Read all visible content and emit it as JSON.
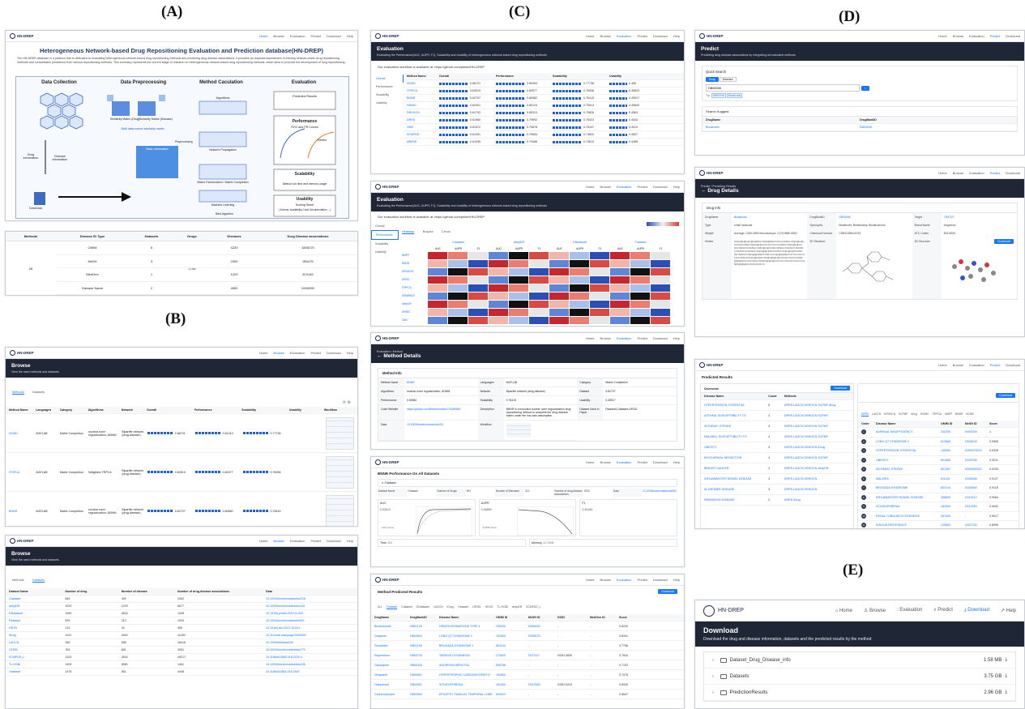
{
  "panel_labels": {
    "a": "(A)",
    "b": "(B)",
    "c": "(C)",
    "d": "(D)",
    "e": "(E)"
  },
  "brand": "HN-DREP",
  "nav": [
    "Home",
    "Browse",
    "Evaluation",
    "Predict",
    "Download",
    "Help"
  ],
  "a": {
    "title": "Heterogeneous Network-based Drug Repositioning Evaluation and Prediction database(HN-DREP)",
    "intro": "The HN-DREP database is a platform that is dedicated to evaluating heterogeneous network-based drug repositioning methods and predicting drug disease associations. It provides an impartial assessment of existing network-driven drug repositioning methods and consolidates predictions from various repositioning methods. This summary represents the current stage of research on heterogeneous network-based drug repositioning methods, which aims to promote the development of drug repositioning.",
    "flow": [
      "Data Collection",
      "Data Preprocessing",
      "Method Caculation",
      "Evaluation"
    ],
    "flow_labels": {
      "drug_info": "Drug information",
      "disease_info": "Disease information",
      "download": "Download",
      "sim_drug": "Similarity Matrix (Drug)",
      "sim_disease": "Similarity Matrix (Disease)",
      "multi_source": "Multi data source similarity matrix",
      "preprocessing": "Preprocessing",
      "basic_info": "Basic information",
      "algorithms": "Algorithms",
      "network_prop": "Network Propagation",
      "matrix_fact": "Matrix Factorization / Matrix Completion",
      "ml": "Machine Learning",
      "best_alg": "Best Algorithm",
      "predicted": "Predicted Results",
      "performance": "Performance",
      "roc": "ROC and PR Curves",
      "metrics": "Metrics",
      "scalability": "Scalability",
      "scal_desc": "Method run time and memory usage",
      "usability": "Usability",
      "scoring": "Scoring Sheet",
      "scoring_desc": "( 6 items: Availability Code Documentation ...)"
    },
    "table": {
      "headers": [
        "Methods",
        "Disease ID Type",
        "Datasets",
        "Drugs",
        "Diseases",
        "Drug Disease associations"
      ],
      "methods": "28",
      "drugs": "2798",
      "rows": [
        [
          "OMIM",
          "5",
          "4220",
          "1805270"
        ],
        [
          "MeSH",
          "3",
          "2392",
          "950475"
        ],
        [
          "MedGen",
          "1",
          "1229",
          "874145"
        ],
        [
          "Disease Name",
          "2",
          "4552",
          "2490059"
        ]
      ]
    }
  },
  "b": {
    "title": "Browse",
    "subtitle": "View the used methods and datasets",
    "tabs": [
      "Methods",
      "Datasets"
    ],
    "methods_headers": [
      "Method Name",
      "Languages",
      "Category",
      "Algorithms",
      "Network",
      "Overall",
      "Performance",
      "Scalability",
      "Usability",
      "Workflow"
    ],
    "methods_rows": [
      [
        "NCMD",
        "MATLAB",
        "Matrix Completion",
        "nuclear-norm regularization, ADMM",
        "Bipartite network (drug-disease)",
        "0.66721",
        "0.81313",
        "0.77736"
      ],
      [
        "ITRPCA",
        "MATLAB",
        "Matrix Completion",
        "Weighted-TRPCA",
        "Bipartite network (drug-disease)",
        "0.63919",
        "0.81577",
        "0.76936"
      ],
      [
        "BNNR",
        "MATLAB",
        "Matrix Completion",
        "nuclear-norm regularization, ADMM",
        "Bipartite network (drug-disease)",
        "0.62707",
        "0.80582",
        "0.76415"
      ]
    ],
    "dataset_headers": [
      "Dataset Name",
      "Number of drug",
      "Number of disease",
      "Number of drug-disease associations",
      "Data"
    ],
    "dataset_rows": [
      [
        "Cdataset",
        "663",
        "409",
        "2352",
        "10.1093/bioinformatics/btw228"
      ],
      [
        "deepDR",
        "1519",
        "1229",
        "6677",
        "10.1093/bioinformatics/btz418"
      ],
      [
        "DNdataset",
        "1490",
        "4516",
        "1008",
        "10.1016/j.ymeth.2019.11.002"
      ],
      [
        "Fdataset",
        "593",
        "313",
        "1933",
        "10.1093/bioinformatics/btr500"
      ],
      [
        "HDVD",
        "219",
        "34",
        "455",
        "10.1016/j.isci.2021.101114"
      ],
      [
        "iDrug",
        "1321",
        "2000",
        "11189",
        "10.1111/sdi.mainpage.0000000"
      ],
      [
        "LAGCN",
        "269",
        "598",
        "18416",
        "10.1093/bib/bbaa150"
      ],
      [
        "LRSSL",
        "763",
        "681",
        "3051",
        "10.1093/bioinformatics/btw770"
      ],
      [
        "SCMFDD_L",
        "1323",
        "2834",
        "49217",
        "10.1186/s12859-018-2220-4"
      ],
      [
        "TL-HGBI",
        "1409",
        "5080",
        "1461",
        "10.1093/bioinformatics/btw045"
      ],
      [
        "Ydataset",
        "1478",
        "651",
        "4448",
        "10.1186/s12864-016-2947"
      ]
    ]
  },
  "c": {
    "title": "Evaluation",
    "subtitle": "Evaluating the Performance(AUC, AUPR, F1), Scalability and Usability of heterogeneous network-based drug repositioning methods",
    "workflow": "Our evaluation workflow is available at: https://github.com/pblab/HN-DREP",
    "side": [
      "Overall",
      "Performance",
      "Scalability",
      "Usability"
    ],
    "overall_headers": [
      "Method Name",
      "Overall",
      "Performance",
      "Scalability",
      "Usability"
    ],
    "overall_rows": [
      [
        "NCMD",
        "0.66721",
        "0.80353",
        "0.77736",
        "0.456"
      ],
      [
        "ITRPCA",
        "0.63919",
        "0.80577",
        "0.76936",
        "0.45823"
      ],
      [
        "BNNR",
        "0.62707",
        "0.80582",
        "0.76415",
        "0.45917"
      ],
      [
        "HGIMC",
        "0.62001",
        "0.80124",
        "0.75914",
        "0.45840"
      ],
      [
        "DRHGCN",
        "0.61793",
        "0.80313",
        "0.75826",
        "0.4563"
      ],
      [
        "DRRS",
        "0.61960",
        "0.79992",
        "0.75323",
        "0.4543"
      ],
      [
        "OMC",
        "0.61572",
        "0.79878",
        "0.75147",
        "0.4519"
      ],
      [
        "SCMFDD",
        "0.61391",
        "0.79654",
        "0.74820",
        "0.4507"
      ],
      [
        "MBiRW",
        "0.61055",
        "0.79486",
        "0.74610",
        "0.4488"
      ]
    ],
    "perf_tabs": [
      "Heatmap",
      "Boxplot",
      "Circos"
    ],
    "perf_groups": [
      "Cdataset",
      "deepDR",
      "DNdataset",
      "Fdataset"
    ],
    "perf_metrics": [
      "AUC",
      "AUPR",
      "F1"
    ],
    "perf_methods": [
      "NMFP",
      "BNNR",
      "DRHGCN",
      "DRRS",
      "ITRPCA",
      "DRWBNCF",
      "deepDR",
      "DRIMC",
      "OMC"
    ],
    "method_detail": {
      "crumb": "Evaluation / Method",
      "title": "Method Details",
      "section": "Method Info",
      "labels": [
        "Method Name",
        "Languages",
        "Category",
        "Algorithms",
        "Network",
        "Dataset",
        "Performance",
        "Scalability",
        "Usability",
        "Code Website",
        "Description",
        "Dataset Used in Paper",
        "Data",
        "Workflow"
      ],
      "values": [
        "BNNR",
        "MATLAB",
        "Matrix Completion",
        "nuclear-norm regularization, ADMM",
        "Bipartite network (drug-disease)",
        "0.62707",
        "0.80582",
        "0.76415",
        "0.45917",
        "https://github.com/BioinformaticsCSU/BNNR",
        "BNNR is a bounded nuclear norm regularization drug repositioning method to complete the drug-disease matrix under the low-rank assumption.",
        "Fdataset,Cdataset,LRSSL",
        "10.1093/bioinformatics/btz331"
      ]
    },
    "per_dataset": {
      "title": "BNNR Performance On All Datasets",
      "dataset": "Fdataset",
      "labels": [
        "Dataset Name",
        "Number of Drugs",
        "Number of Diseases",
        "Number of drug-disease associations",
        "Data"
      ],
      "values": [
        "Fdataset",
        "593",
        "313",
        "1933",
        "10.1093/bioinformatics/btr500"
      ],
      "metrics": [
        "AUC",
        "AUPR",
        "F1"
      ],
      "auc": "0.93612",
      "aupr": "0.46889",
      "f1": "0.45189",
      "auc_curve": "AUC Curve",
      "aupr_curve": "AUPR Curve",
      "time": "Time",
      "memory": "Memory",
      "time_val": "200",
      "mem_val": "1170MB"
    },
    "predicted": {
      "title": "Method Predicted Results",
      "download": "Download",
      "tabs": [
        "ALL",
        "Fdataset",
        "Cdataset",
        "DNdataset",
        "LAGCN",
        "iDrug",
        "Ydataset",
        "LRSSL",
        "HDVD",
        "TL-HGBI",
        "deepDR",
        "SCMFDD_L"
      ],
      "headers": [
        "DrugName",
        "DrugBankID",
        "Disease Name",
        "OMIM ID",
        "MeSH ID",
        "DOID",
        "MedGen ID",
        "Score"
      ],
      "rows": [
        [
          "Bicalutamide",
          "DB01128",
          "HEMOCHROMATOSIS TYPE 1",
          "235200",
          "D006432",
          "-",
          "-",
          "0.8232"
        ],
        [
          "Cisapride",
          "DB00604",
          "LONG QT SYNDROME 1",
          "192500",
          "D008133",
          "-",
          "-",
          "0.8151"
        ],
        [
          "Flecainide",
          "DB01195",
          "BRUGADA SYNDROME 1",
          "601144",
          "-",
          "-",
          "-",
          "0.7756"
        ],
        [
          "Risperidone",
          "DB00734",
          "TARDIVE DYSKINESIA",
          "272620",
          "D071117",
          "DOID:2830",
          "-",
          "0.7644"
        ],
        [
          "Olanzapine",
          "DB00334",
          "ANOREXIA NERVOSA",
          "606788",
          "-",
          "-",
          "-",
          "0.7192"
        ],
        [
          "Verapamil",
          "DB00661",
          "HYPERTROPHIC CARDIOMYOPATHY",
          "192600",
          "-",
          "-",
          "-",
          "0.7078"
        ],
        [
          "Haloperidol",
          "DB00502",
          "SCHIZOPHRENIA",
          "181500",
          "D012559",
          "DOID:5419",
          "-",
          "0.6926"
        ],
        [
          "Carbamazepine",
          "DB00564",
          "EPILEPSY, FAMILIAL TEMPORAL LOBE",
          "600512",
          "-",
          "-",
          "-",
          "0.6647"
        ]
      ]
    }
  },
  "d": {
    "predict_title": "Predict",
    "predict_subtitle": "Predicting drug disease associations by integrating all evaluated methods",
    "quick": "Quick Search",
    "toggle": [
      "Drug",
      "Disease"
    ],
    "query": "DB00006",
    "tags_label": "Try:",
    "tags": [
      "DB00006",
      "Bivalirudin"
    ],
    "suggest": "Search Suggest",
    "suggest_headers": [
      "DrugName",
      "DrugBankID"
    ],
    "suggest_row": [
      "Bivalirudin",
      "DB00006"
    ],
    "detail_crumb": "Predict / Predicting Results",
    "detail_title": "Drug Details",
    "drug_info": "Drug Info",
    "labels": [
      "DrugName",
      "DrugBankID",
      "Target",
      "Type",
      "Synonyms",
      "Brand Name",
      "Weight",
      "Chemical Formula",
      "ATC Codes",
      "Smiles",
      "2D Structure",
      "3D Structure"
    ],
    "values": [
      "Bivalirudin",
      "DB00006",
      "TRATV2",
      "small molecule",
      "Bivalirudin; Bivalirudina; Bivalirudinum",
      "Angiomax",
      "Average: 2180.2853 Monoisotopic: 2178.9860 6562",
      "C98H138N24O33",
      "B01AE06"
    ],
    "smiles": "CC[C@H](C)[C@H](NC(=O)[C@H](CCC(O)=O)NC(=O)[C@H](CCC(O)=O)NC(=O)[C@H](CC1=CC=CC=C1)NC(=O)[C@H](CC(O)=O)NC(=O)CNC(=O)[C@H](CC(N)=O)NC(=O)CNC(=O)CNC(=O)CNC(=O)CNC(=O)[C@@H]1CCCN1C(=O)[C@H](CCCNC(N)=N)NC(=O)[C@@H]1CCCN1C(=O)[C@H](N)CC1=CC=CC=C1)C(=O)N1CCC[C@H]1C(=O)N[C@@H](CCC(O)=O)C(=O)N[C@@H](CCC(O)=O)C(=O)N[C@@H](CC1=CC=C(O)C=C1)C(=O)N[C@@H](CC(C)C)C(O)=O",
    "download": "Download",
    "pred_title": "Predicted Results",
    "overview": "Overview",
    "ov_headers": [
      "Disease Name",
      "Count",
      "Methods"
    ],
    "ov_rows": [
      [
        "HYPERTENSION, ESSENTIAL",
        "5",
        "DRRS LAGCN DRHGCN SCPMF iDrug"
      ],
      [
        "ASTHMA, SUSCEPTIBILITY TO",
        "4",
        "DRRS LAGCN DRHGCN SCPMF"
      ],
      [
        "ISCHEMIC STROKE",
        "4",
        "DRRS LAGCN DRHGCN SCPMF"
      ],
      [
        "MALARIA, SUSCEPTIBILITY TO",
        "4",
        "DRRS LAGCN DRHGCN SCPMF"
      ],
      [
        "OBESITY",
        "4",
        "DRRS LAGCN DRHGCN iDrug"
      ],
      [
        "MYOCARDIAL INFARCTION",
        "4",
        "DRRS LAGCN DRHGCN SCPMF"
      ],
      [
        "BREAST CANCER",
        "4",
        "DRRS LAGCN DRHGCN deepDR"
      ],
      [
        "INFLAMMATORY BOWEL DISEASE",
        "3",
        "DRRS LAGCN DRHGCN"
      ],
      [
        "ALZHEIMER DISEASE",
        "3",
        "DRRS LAGCN DRHGCN"
      ],
      [
        "PARKINSON DISEASE",
        "2",
        "DRRS iDrug"
      ]
    ],
    "right_tabs": [
      "DRRS",
      "LAGCN",
      "DRHGCN",
      "SCPMF",
      "iDrug",
      "HGIMC",
      "ITRPCA",
      "NMFP",
      "BNNR",
      "NCMD"
    ],
    "right_headers": [
      "Order",
      "Disease Name",
      "OMIM ID",
      "MeSH ID",
      "Score"
    ],
    "right_rows": [
      [
        "1",
        "ADRENAL INSUFFICIENCY",
        "240200",
        "D000309",
        "1"
      ],
      [
        "2",
        "LONG QT SYNDROME 2",
        "613688",
        "D008133",
        "0.9995"
      ],
      [
        "3",
        "HYPERTENSION, ESSENTIAL",
        "145500",
        "D000075222",
        "0.9328"
      ],
      [
        "4",
        "OBESITY",
        "601665",
        "D009765",
        "0.9211"
      ],
      [
        "5",
        "ISCHEMIC STROKE",
        "601367",
        "D000083242",
        "0.9153"
      ],
      [
        "6",
        "MALARIA",
        "611162",
        "D008288",
        "0.9127"
      ],
      [
        "7",
        "BRUGADA SYNDROME",
        "601144",
        "D053840",
        "0.9118"
      ],
      [
        "8",
        "INFLAMMATORY BOWEL DISEASE",
        "266600",
        "D015212",
        "0.9064"
      ],
      [
        "9",
        "SCHIZOPHRENIA",
        "181500",
        "D012559",
        "0.9032"
      ],
      [
        "10",
        "RENAL TUBULAR DYSGENESIS",
        "267430",
        "-",
        "0.9017"
      ],
      [
        "11",
        "INSULIN RESISTANCE",
        "125853",
        "D007333",
        "0.8995"
      ]
    ]
  },
  "e": {
    "title": "Download",
    "subtitle": "Download the drug and disease information, datasets and the predicted results by the method",
    "files": [
      {
        "name": "Dataset_Drug_Disease_info",
        "size": "1.58 MB"
      },
      {
        "name": "Datasets",
        "size": "3.75 GB"
      },
      {
        "name": "PredictionResults",
        "size": "2.96 GB"
      }
    ]
  }
}
